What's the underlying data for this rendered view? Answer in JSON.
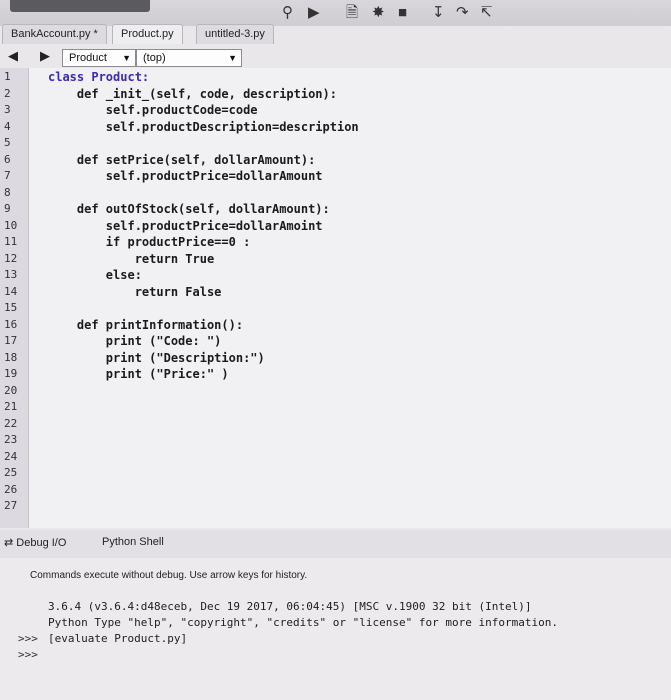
{
  "toolbar": {
    "icons": [
      "search-icon",
      "run-icon",
      "document-icon",
      "debug-icon",
      "stop-icon",
      "step-icon",
      "step-over-icon",
      "step-out-icon"
    ]
  },
  "tabs": [
    {
      "label": "BankAccount.py *"
    },
    {
      "label": "Product.py"
    },
    {
      "label": "untitled-3.py"
    }
  ],
  "nav": {
    "class_combo": "Product",
    "scope_combo": "(top)"
  },
  "editor": {
    "line_numbers": [
      "1",
      "2",
      "3",
      "4",
      "5",
      "6",
      "7",
      "8",
      "9",
      "10",
      "11",
      "12",
      "13",
      "14",
      "15",
      "16",
      "17",
      "18",
      "19",
      "20",
      "21",
      "22",
      "23",
      "24",
      "25",
      "26",
      "27"
    ],
    "lines": [
      "class Product:",
      "    def _init_(self, code, description):",
      "        self.productCode=code",
      "        self.productDescription=description",
      "",
      "    def setPrice(self, dollarAmount):",
      "        self.productPrice=dollarAmount",
      "",
      "    def outOfStock(self, dollarAmount):",
      "        self.productPrice=dollarAmoint",
      "        if productPrice==0 :",
      "            return True",
      "        else:",
      "            return False",
      "",
      "    def printInformation():",
      "        print (\"Code: \")",
      "        print (\"Description:\")",
      "        print (\"Price:\" )"
    ]
  },
  "shell": {
    "tabs": [
      {
        "label": "Debug I/O"
      },
      {
        "label": "Python Shell"
      }
    ],
    "hint": "Commands execute without debug. Use arrow keys for history.",
    "output": [
      "3.6.4 (v3.6.4:d48eceb, Dec 19 2017, 06:04:45) [MSC v.1900 32 bit (Intel)]",
      "Python Type \"help\", \"copyright\", \"credits\" or \"license\" for more information.",
      "[evaluate Product.py]"
    ],
    "prompt": ">>>"
  }
}
